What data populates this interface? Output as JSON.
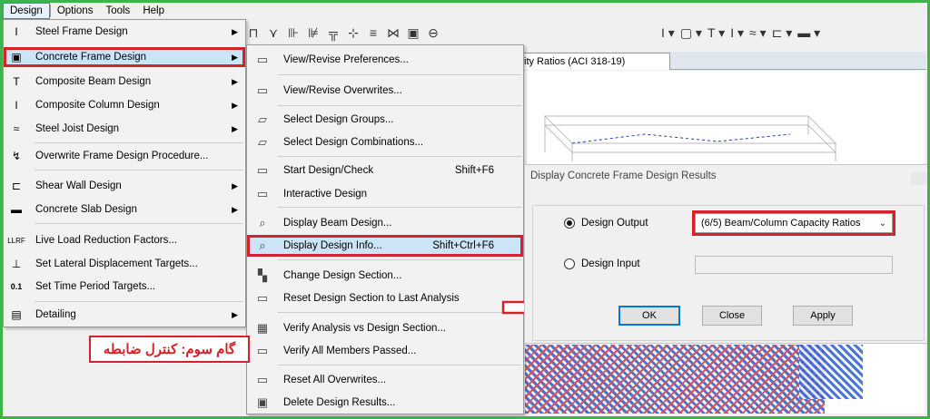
{
  "menubar": {
    "items": [
      "Design",
      "Options",
      "Tools",
      "Help"
    ]
  },
  "tab": {
    "label": "ity Ratios  (ACI 318-19)"
  },
  "design_menu": {
    "items": [
      {
        "label": "Steel Frame Design",
        "icon": "I",
        "arrow": "▶"
      },
      {
        "label": "Concrete Frame Design",
        "icon": "▣",
        "arrow": "▶"
      },
      {
        "label": "Composite Beam Design",
        "icon": "T",
        "arrow": "▶"
      },
      {
        "label": "Composite Column Design",
        "icon": "I",
        "arrow": "▶"
      },
      {
        "label": "Steel Joist Design",
        "icon": "≈",
        "arrow": "▶"
      },
      {
        "label": "Overwrite Frame Design Procedure...",
        "icon": "↯",
        "arrow": ""
      },
      {
        "label": "Shear Wall Design",
        "icon": "⊏",
        "arrow": "▶"
      },
      {
        "label": "Concrete Slab Design",
        "icon": "▬",
        "arrow": "▶"
      },
      {
        "label": "Live Load Reduction Factors...",
        "icon": "LLRF",
        "arrow": ""
      },
      {
        "label": "Set Lateral Displacement Targets...",
        "icon": "⊥",
        "arrow": ""
      },
      {
        "label": "Set Time Period Targets...",
        "icon": "0.1",
        "arrow": ""
      },
      {
        "label": "Detailing",
        "icon": "▤",
        "arrow": "▶"
      }
    ]
  },
  "concrete_submenu": {
    "items": [
      {
        "label": "View/Revise Preferences...",
        "shortcut": ""
      },
      {
        "label": "View/Revise Overwrites...",
        "shortcut": ""
      },
      {
        "label": "Select Design Groups...",
        "shortcut": ""
      },
      {
        "label": "Select Design Combinations...",
        "shortcut": ""
      },
      {
        "label": "Start Design/Check",
        "shortcut": "Shift+F6"
      },
      {
        "label": "Interactive Design",
        "shortcut": ""
      },
      {
        "label": "Display Beam Design...",
        "shortcut": ""
      },
      {
        "label": "Display Design Info...",
        "shortcut": "Shift+Ctrl+F6"
      },
      {
        "label": "Change Design Section...",
        "shortcut": ""
      },
      {
        "label": "Reset Design Section to Last Analysis",
        "shortcut": ""
      },
      {
        "label": "Verify Analysis vs Design Section...",
        "shortcut": ""
      },
      {
        "label": "Verify All Members Passed...",
        "shortcut": ""
      },
      {
        "label": "Reset All Overwrites...",
        "shortcut": ""
      },
      {
        "label": "Delete Design Results...",
        "shortcut": ""
      }
    ]
  },
  "annotation": {
    "step_text": "گام سوم: کنترل ضابطه"
  },
  "dialog": {
    "title": "Display Concrete Frame Design Results",
    "output_label": "Design Output",
    "input_label": "Design Input",
    "selected_output": "(6/5) Beam/Column Capacity Ratios",
    "ok": "OK",
    "close": "Close",
    "apply": "Apply"
  },
  "colors": {
    "highlight_border": "#d4212a",
    "frame_border": "#3fb24a",
    "selection_bg": "#cce4f7"
  }
}
